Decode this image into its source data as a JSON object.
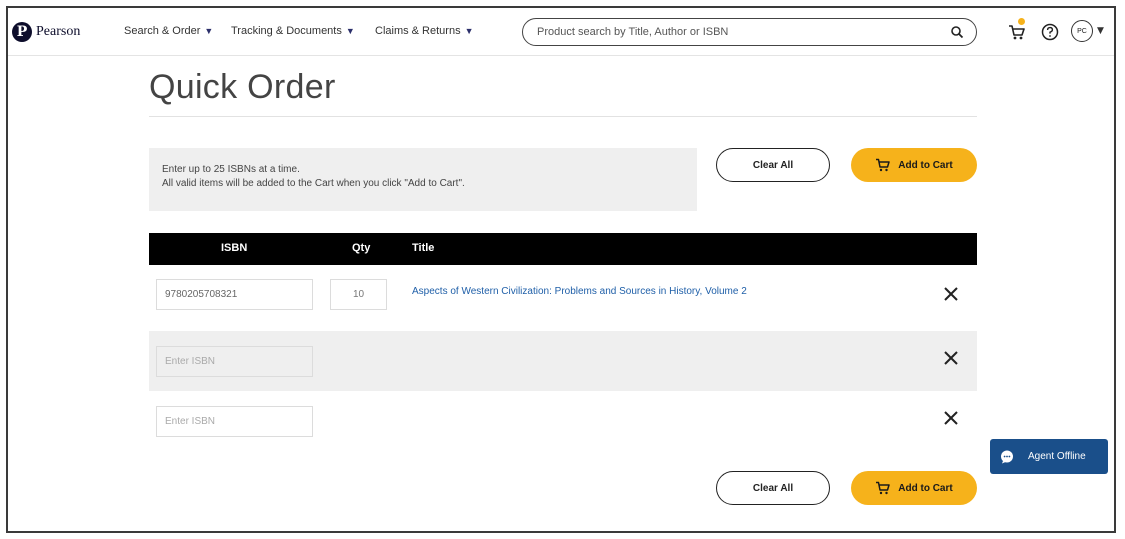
{
  "brand": {
    "name": "Pearson",
    "logo_letter": "P"
  },
  "nav": [
    {
      "label": "Search & Order"
    },
    {
      "label": "Tracking & Documents"
    },
    {
      "label": "Claims & Returns"
    }
  ],
  "search": {
    "placeholder": "Product search by Title, Author or ISBN"
  },
  "header_icons": [
    "cart-icon",
    "help-icon"
  ],
  "user": {
    "initials": "PC"
  },
  "page": {
    "title": "Quick Order"
  },
  "info": {
    "line1": "Enter up to 25 ISBNs at a time.",
    "line2": "All valid items will be added to the Cart when you click \"Add to Cart\"."
  },
  "buttons": {
    "clear_all": "Clear All",
    "add_to_cart": "Add to Cart"
  },
  "table": {
    "headers": {
      "isbn": "ISBN",
      "qty": "Qty",
      "title": "Title"
    },
    "rows": [
      {
        "isbn": "9780205708321",
        "qty": "10",
        "title": "Aspects of Western Civilization: Problems and Sources in History, Volume 2"
      },
      {
        "isbn_placeholder": "Enter ISBN"
      },
      {
        "isbn_placeholder": "Enter ISBN"
      }
    ]
  },
  "chat": {
    "label": "Agent Offline"
  },
  "colors": {
    "accent": "#f6b21b",
    "link": "#1f5fa8",
    "chat": "#1a4f8a",
    "table_header": "#000000"
  }
}
